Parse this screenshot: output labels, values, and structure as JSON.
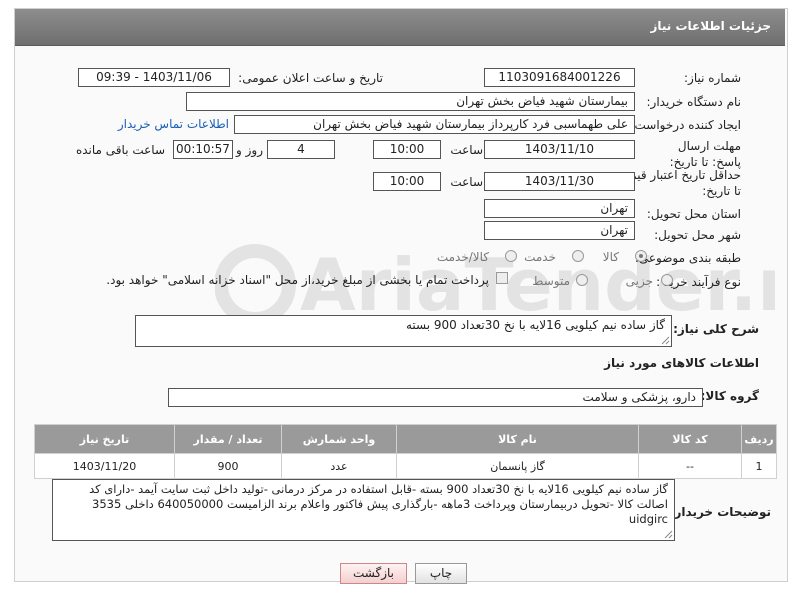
{
  "header": {
    "title": "جزئیات اطلاعات نیاز"
  },
  "need_number": {
    "label": "شماره نیاز:",
    "value": "1103091684001226"
  },
  "announce_datetime": {
    "label": "تاریخ و ساعت اعلان عمومی:",
    "value": "1403/11/06 - 09:39"
  },
  "buyer_org": {
    "label": "نام دستگاه خریدار:",
    "value": "بیمارستان شهید فیاض بخش تهران"
  },
  "request_creator": {
    "label": "ایجاد کننده درخواست:",
    "value": "علی طهماسبی فرد کارپرداز بیمارستان شهید فیاض بخش تهران",
    "contact_link": "اطلاعات تماس خریدار"
  },
  "deadline": {
    "label": "مهلت ارسال پاسخ: تا تاریخ:",
    "date": "1403/11/10",
    "time_label": "ساعت",
    "time": "10:00",
    "days": "4",
    "days_label": "روز و",
    "remaining": "00:10:57",
    "remaining_label": "ساعت باقی مانده"
  },
  "price_validity": {
    "label": "حداقل تاریخ اعتبار قیمت: تا تاریخ:",
    "date": "1403/11/30",
    "time_label": "ساعت",
    "time": "10:00"
  },
  "delivery_province": {
    "label": "استان محل تحویل:",
    "value": "تهران"
  },
  "delivery_city": {
    "label": "شهر محل تحویل:",
    "value": "تهران"
  },
  "category": {
    "label": "طبقه بندی موضوعی:",
    "options": [
      "کالا",
      "خدمت",
      "کالا/خدمت"
    ],
    "selected": "کالا"
  },
  "purchase_type": {
    "label": "نوع فرآیند خرید :",
    "options": [
      "جزیی",
      "متوسط"
    ],
    "selected": "",
    "note": "پرداخت تمام یا بخشی از مبلغ خرید،از محل \"اسناد خزانه اسلامی\" خواهد بود."
  },
  "description": {
    "label": "شرح کلی نیاز:",
    "value": "گاز ساده نیم کیلویی 16لایه با نخ 30تعداد 900 بسته"
  },
  "goods_info_title": "اطلاعات کالاهای مورد نیاز",
  "goods_group": {
    "label": "گروه کالا:",
    "value": "دارو، پزشکی و سلامت"
  },
  "table": {
    "headers": [
      "ردیف",
      "کد کالا",
      "نام کالا",
      "واحد شمارش",
      "تعداد / مقدار",
      "تاریخ نیاز"
    ],
    "rows": [
      {
        "row": "1",
        "code": "--",
        "name": "گاز پانسمان",
        "unit": "عدد",
        "qty": "900",
        "date": "1403/11/20"
      }
    ]
  },
  "buyer_notes": {
    "label": "توضیحات خریدار:",
    "lines": [
      "گاز ساده نیم کیلویی 16لایه با نخ 30تعداد 900 بسته -قابل استفاده در مرکز درمانی -تولید داخل ثبت سایت آیمد -دارای کد",
      "اصالت کالا -تحویل دربیمارستان وپرداخت 3ماهه -بارگذاری پیش فاکتور واعلام برند الزامیست 640050000 داخلی 3535 uidgirc"
    ]
  },
  "buttons": {
    "print": "چاپ",
    "back": "بازگشت"
  },
  "watermark": "AriaTender.neT"
}
